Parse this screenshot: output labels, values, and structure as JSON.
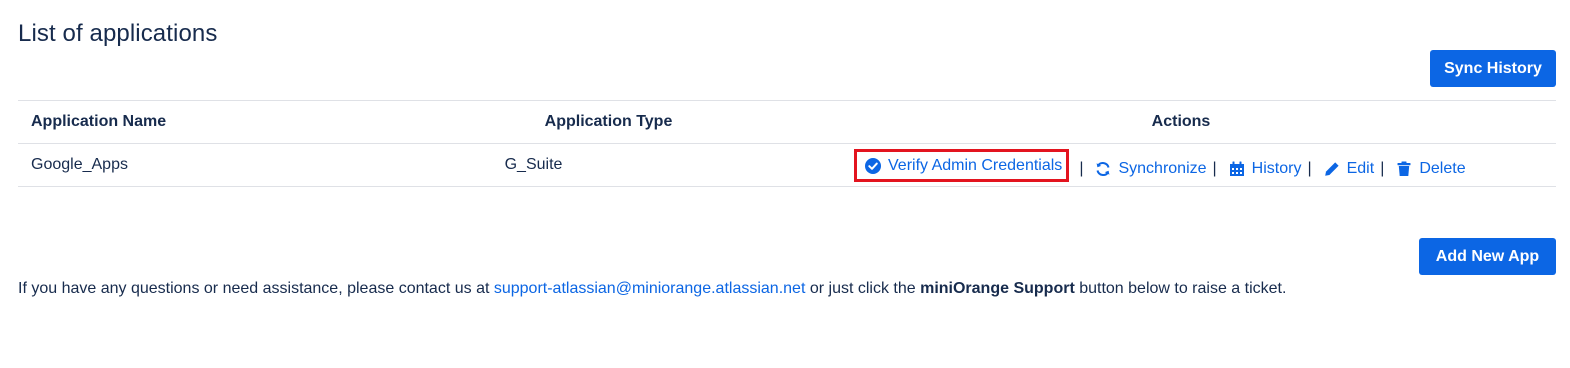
{
  "page": {
    "title": "List of applications"
  },
  "buttons": {
    "sync_history": "Sync History",
    "add_new_app": "Add New App"
  },
  "table": {
    "headers": {
      "name": "Application Name",
      "type": "Application Type",
      "actions": "Actions"
    },
    "rows": [
      {
        "name": "Google_Apps",
        "type": "G_Suite",
        "actions": {
          "verify": "Verify Admin Credentials",
          "synchronize": "Synchronize",
          "history": "History",
          "edit": "Edit",
          "delete": "Delete",
          "separator": "|"
        }
      }
    ]
  },
  "footer": {
    "prefix": "If you have any questions or need assistance, please contact us at ",
    "email": "support-atlassian@miniorange.atlassian.net",
    "middle": " or just click the ",
    "bold": "miniOrange Support",
    "suffix": " button below to raise a ticket."
  },
  "icons": {
    "verify": "check-circle-icon",
    "synchronize": "sync-icon",
    "history": "calendar-icon",
    "edit": "pencil-icon",
    "delete": "trash-icon"
  },
  "colors": {
    "primary": "#0c66e4",
    "text": "#172b4d",
    "highlight_border": "#e3141f",
    "divider": "#dfe1e6"
  }
}
